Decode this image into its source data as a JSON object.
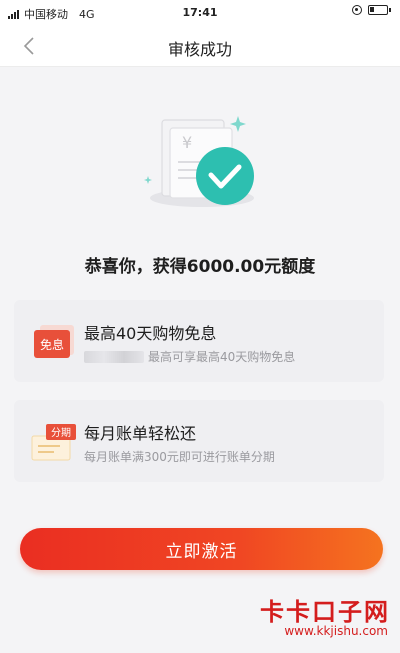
{
  "status_bar": {
    "carrier": "中国移动",
    "network": "4G",
    "time": "17:41"
  },
  "nav": {
    "title": "审核成功"
  },
  "success": {
    "message": "恭喜你，获得6000.00元额度"
  },
  "cards": [
    {
      "badge": "免息",
      "title": "最高40天购物免息",
      "subtitle": "最高可享最高40天购物免息"
    },
    {
      "badge": "分期",
      "title": "每月账单轻松还",
      "subtitle": "每月账单满300元即可进行账单分期"
    }
  ],
  "action": {
    "activate_label": "立即激活"
  },
  "watermark": {
    "logo": "卡卡口子网",
    "url": "www.kkjishu.com"
  },
  "colors": {
    "accent": "#ee3a24",
    "check": "#2dbfb0",
    "badge_red": "#e8503a",
    "watermark": "#d41d1d"
  }
}
